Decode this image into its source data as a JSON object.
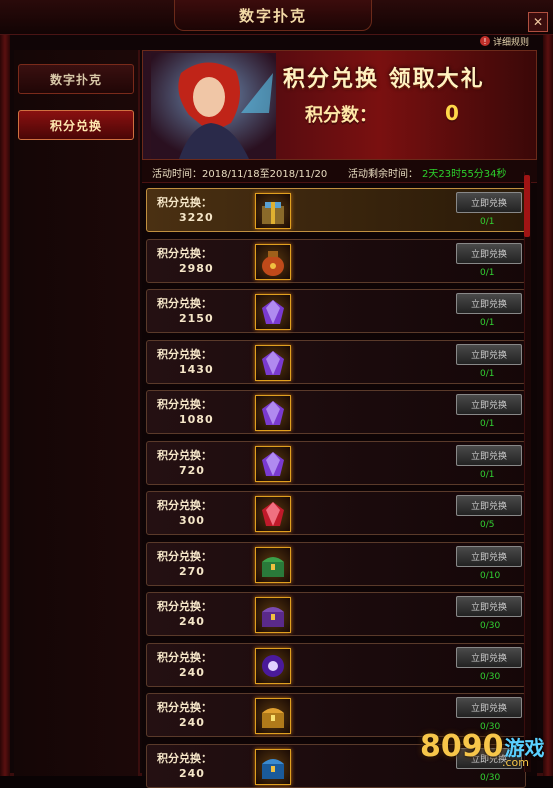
{
  "window": {
    "title": "数字扑克",
    "close_glyph": "✕",
    "rules_label": "详细规则",
    "rules_icon_glyph": "!"
  },
  "sidebar": {
    "items": [
      {
        "label": "数字扑克",
        "active": false
      },
      {
        "label": "积分兑换",
        "active": true
      }
    ]
  },
  "banner": {
    "title": "积分兑换 领取大礼",
    "points_label": "积分数：",
    "points_value": "0"
  },
  "activity": {
    "time_label": "活动时间：2018/11/18至2018/11/20",
    "remaining_label": "活动剩余时间：",
    "remaining_value": "2天23时55分34秒"
  },
  "rows": [
    {
      "label": "积分兑换：",
      "cost": "3220",
      "icon": "gift-box-icon",
      "button": "立即兑换",
      "limit": "0/1"
    },
    {
      "label": "积分兑换：",
      "cost": "2980",
      "icon": "treasure-bag-icon",
      "button": "立即兑换",
      "limit": "0/1"
    },
    {
      "label": "积分兑换：",
      "cost": "2150",
      "icon": "purple-gem-icon",
      "button": "立即兑换",
      "limit": "0/1"
    },
    {
      "label": "积分兑换：",
      "cost": "1430",
      "icon": "purple-gem-icon",
      "button": "立即兑换",
      "limit": "0/1"
    },
    {
      "label": "积分兑换：",
      "cost": "1080",
      "icon": "purple-gem-icon",
      "button": "立即兑换",
      "limit": "0/1"
    },
    {
      "label": "积分兑换：",
      "cost": "720",
      "icon": "purple-gem-icon",
      "button": "立即兑换",
      "limit": "0/1"
    },
    {
      "label": "积分兑换：",
      "cost": "300",
      "icon": "red-gem-icon",
      "button": "立即兑换",
      "limit": "0/5"
    },
    {
      "label": "积分兑换：",
      "cost": "270",
      "icon": "green-chest-icon",
      "button": "立即兑换",
      "limit": "0/10"
    },
    {
      "label": "积分兑换：",
      "cost": "240",
      "icon": "purple-chest-icon",
      "button": "立即兑换",
      "limit": "0/30"
    },
    {
      "label": "积分兑换：",
      "cost": "240",
      "icon": "purple-orb-icon",
      "button": "立即兑换",
      "limit": "0/30"
    },
    {
      "label": "积分兑换：",
      "cost": "240",
      "icon": "gold-chest-icon",
      "button": "立即兑换",
      "limit": "0/30"
    },
    {
      "label": "积分兑换：",
      "cost": "240",
      "icon": "blue-chest-icon",
      "button": "立即兑换",
      "limit": "0/30"
    }
  ],
  "watermark": {
    "number": "8090",
    "text": "游戏",
    "suffix": ".com"
  },
  "colors": {
    "accent_red": "#8a1010",
    "gold": "#f7c64a",
    "limit_green": "#32d232"
  }
}
